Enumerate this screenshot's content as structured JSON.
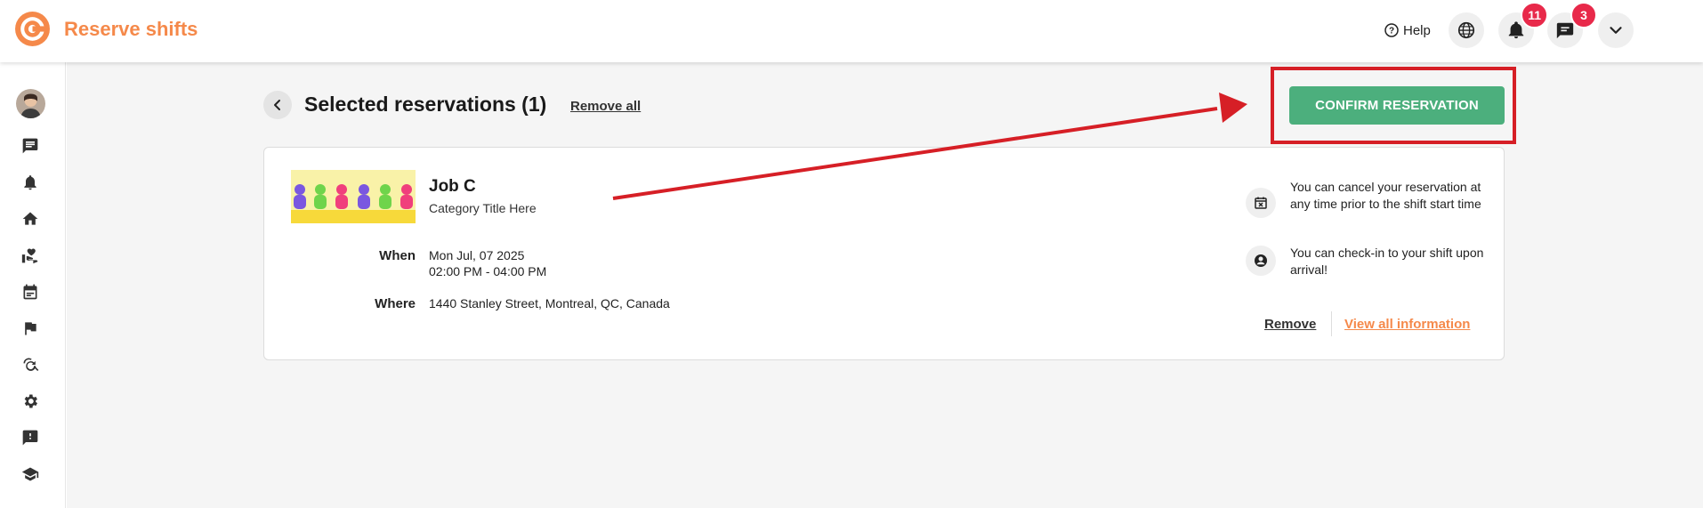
{
  "app": {
    "title": "Reserve shifts"
  },
  "header": {
    "help_label": "Help",
    "notifications_count": "11",
    "messages_count": "3"
  },
  "sidebar": {
    "items": [
      {
        "icon": "chat-icon"
      },
      {
        "icon": "bell-icon"
      },
      {
        "icon": "home-icon"
      },
      {
        "icon": "volunteer-hand-icon"
      },
      {
        "icon": "calendar-icon"
      },
      {
        "icon": "flag-icon"
      },
      {
        "icon": "search-refresh-icon"
      },
      {
        "icon": "gear-icon"
      },
      {
        "icon": "feedback-icon"
      },
      {
        "icon": "graduation-cap-icon"
      }
    ]
  },
  "page": {
    "title": "Selected reservations (1)",
    "remove_all_label": "Remove all",
    "confirm_label": "CONFIRM RESERVATION"
  },
  "reservation": {
    "job_title": "Job C",
    "category": "Category Title Here",
    "when_label": "When",
    "date": "Mon Jul, 07 2025",
    "time": "02:00 PM - 04:00 PM",
    "where_label": "Where",
    "address": "1440 Stanley Street, Montreal, QC, Canada",
    "info": [
      {
        "icon": "calendar-cancel-icon",
        "text": "You can cancel your reservation at any time prior to the shift start time"
      },
      {
        "icon": "user-check-icon",
        "text": "You can check-in to your shift upon arrival!"
      }
    ],
    "remove_label": "Remove",
    "view_all_label": "View all information"
  },
  "colors": {
    "brand": "#f5894a",
    "confirm": "#4caf7d",
    "badge": "#e8294a",
    "annotation": "#d61f26"
  }
}
